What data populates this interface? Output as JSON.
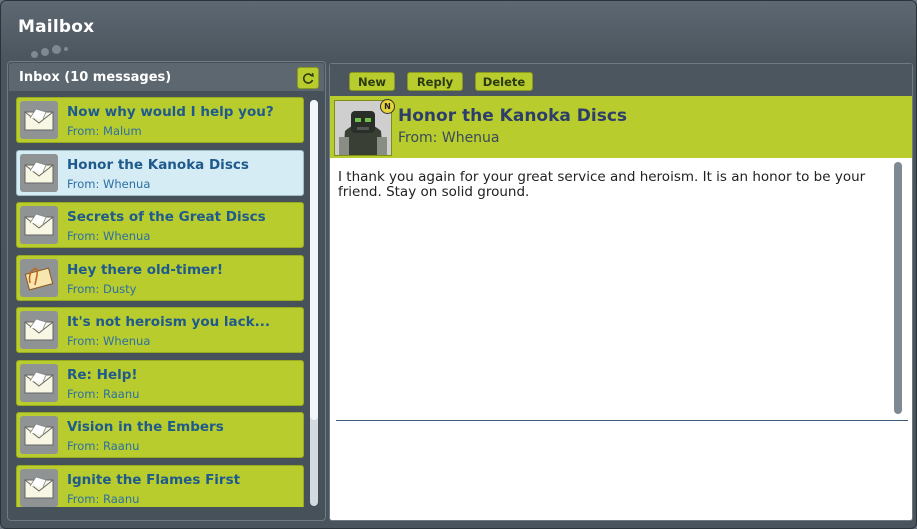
{
  "window": {
    "title": "Mailbox"
  },
  "inbox": {
    "title": "Inbox (10 messages)",
    "refresh_icon": "refresh-icon",
    "messages": [
      {
        "subject": "Now why would I help you?",
        "from": "From: Malum",
        "icon": "envelope-icon",
        "selected": false
      },
      {
        "subject": "Honor the Kanoka Discs",
        "from": "From: Whenua",
        "icon": "envelope-icon",
        "selected": true
      },
      {
        "subject": "Secrets of the Great Discs",
        "from": "From: Whenua",
        "icon": "envelope-icon",
        "selected": false
      },
      {
        "subject": "Hey there old-timer!",
        "from": "From: Dusty",
        "icon": "attachment-envelope-icon",
        "selected": false
      },
      {
        "subject": "It's not heroism you lack...",
        "from": "From: Whenua",
        "icon": "envelope-icon",
        "selected": false
      },
      {
        "subject": "Re: Help!",
        "from": "From: Raanu",
        "icon": "envelope-icon",
        "selected": false
      },
      {
        "subject": "Vision in the Embers",
        "from": "From: Raanu",
        "icon": "envelope-icon",
        "selected": false
      },
      {
        "subject": "Ignite the Flames First",
        "from": "From: Raanu",
        "icon": "envelope-icon",
        "selected": false
      }
    ]
  },
  "toolbar": {
    "new_label": "New",
    "reply_label": "Reply",
    "delete_label": "Delete"
  },
  "reader": {
    "subject": "Honor the Kanoka Discs",
    "from": "From: Whenua",
    "badge": "N",
    "body": "I thank you again for your great service and heroism. It is an honor to be your friend. Stay on solid ground."
  },
  "colors": {
    "accent": "#b8cc2e",
    "selected": "#d5ecf4",
    "subject_text": "#1f5a8c",
    "window_bg": "#4b555e"
  }
}
